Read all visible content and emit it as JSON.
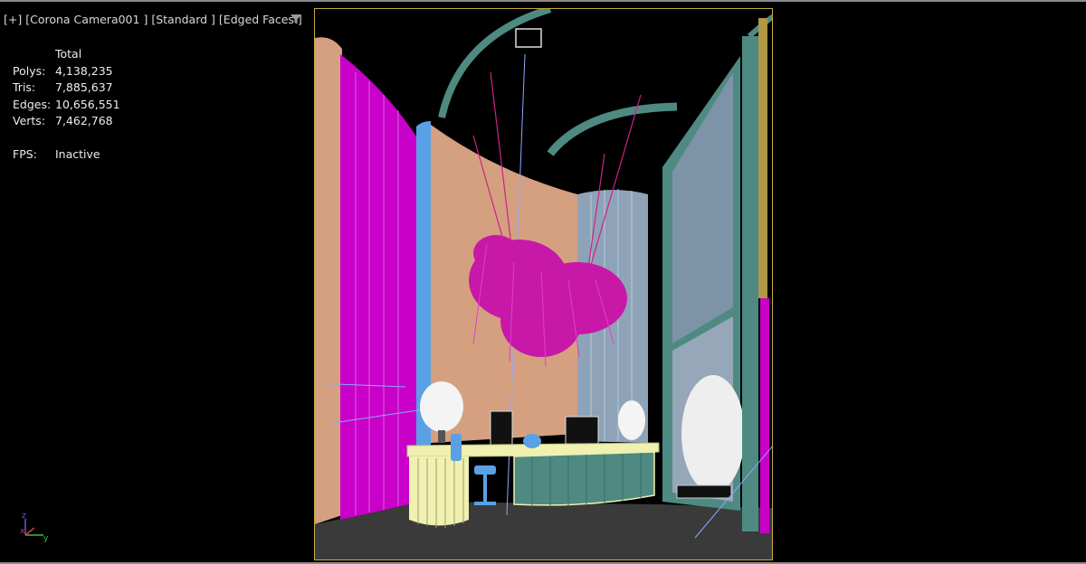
{
  "viewport": {
    "labels": {
      "plus": "[+]",
      "camera": "[Corona Camera001 ]",
      "shading": "[Standard ]",
      "edges": "[Edged Faces ]"
    },
    "filter_icon": "filter-funnel-icon"
  },
  "stats": {
    "header": "Total",
    "rows": [
      {
        "label": "Polys:",
        "value": "4,138,235"
      },
      {
        "label": "Tris:",
        "value": "7,885,637"
      },
      {
        "label": "Edges:",
        "value": "10,656,551"
      },
      {
        "label": "Verts:",
        "value": "7,462,768"
      }
    ],
    "fps_label": "FPS:",
    "fps_value": "Inactive"
  },
  "axis": {
    "z": "z",
    "x": "x",
    "y": "y"
  },
  "colors": {
    "safe_frame": "#c9a94a",
    "viewport_border": "#8a8a8a",
    "magenta": "#c800c8",
    "wall_tan": "#d4a080",
    "teal": "#4e8a82",
    "blue": "#5aa0e6",
    "yellow_desk": "#f0f0b0"
  }
}
